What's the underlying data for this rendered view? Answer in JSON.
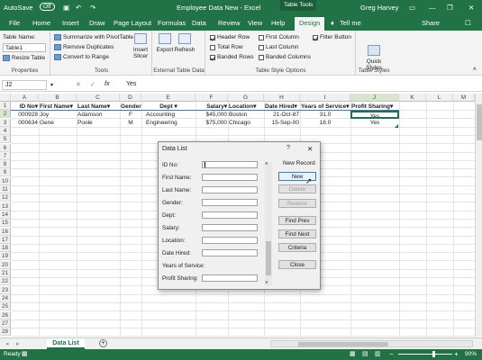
{
  "titlebar": {
    "autosave": "AutoSave",
    "autosave_state": "Off",
    "doc_title": "Employee Data New  -  Excel",
    "context_tab": "Table Tools",
    "user": "Greg Harvey"
  },
  "tabs": [
    "File",
    "Home",
    "Insert",
    "Draw",
    "Page Layout",
    "Formulas",
    "Data",
    "Review",
    "View",
    "Help",
    "Design"
  ],
  "tell_me": "Tell me",
  "share": "Share",
  "ribbon": {
    "properties": {
      "label": "Properties",
      "name_label": "Table Name:",
      "name_value": "Table1",
      "resize": "Resize Table"
    },
    "tools": {
      "label": "Tools",
      "items": [
        "Summarize with PivotTable",
        "Remove Duplicates",
        "Convert to Range"
      ],
      "slicer": "Insert Slicer"
    },
    "external": {
      "label": "External Table Data",
      "export": "Export",
      "refresh": "Refresh"
    },
    "style_options": {
      "label": "Table Style Options",
      "items": [
        {
          "label": "Header Row",
          "checked": true
        },
        {
          "label": "Total Row",
          "checked": false
        },
        {
          "label": "Banded Rows",
          "checked": true
        },
        {
          "label": "First Column",
          "checked": false
        },
        {
          "label": "Last Column",
          "checked": false
        },
        {
          "label": "Banded Columns",
          "checked": false
        },
        {
          "label": "Filter Button",
          "checked": true
        }
      ]
    },
    "styles": {
      "label": "Table Styles",
      "quick": "Quick Styles"
    }
  },
  "formula_bar": {
    "namebox": "J2",
    "fx": "fx",
    "value": "Yes"
  },
  "columns": [
    "A",
    "B",
    "C",
    "D",
    "E",
    "F",
    "G",
    "H",
    "I",
    "J",
    "K",
    "L",
    "M"
  ],
  "headers": [
    "ID No",
    "First Name",
    "Last Name",
    "Gender",
    "Dept",
    "Salary",
    "Location",
    "Date Hired",
    "Years of Service",
    "Profit Sharing"
  ],
  "rows": [
    [
      "000928",
      "Joy",
      "Adamson",
      "F",
      "Accounting",
      "$45,000",
      "Boston",
      "21-Oct-87",
      "31.0",
      "Yes"
    ],
    [
      "000634",
      "Gene",
      "Poole",
      "M",
      "Engineering",
      "$75,000",
      "Chicago",
      "15-Sep-00",
      "18.0",
      "Yes"
    ]
  ],
  "row_numbers": [
    "1",
    "2",
    "3",
    "4",
    "5",
    "6",
    "7",
    "8",
    "9",
    "10",
    "11",
    "12",
    "13",
    "14",
    "15",
    "16",
    "17",
    "18",
    "19",
    "20",
    "21",
    "22",
    "23",
    "24",
    "25",
    "26",
    "27",
    "28"
  ],
  "dialog": {
    "title": "Data List",
    "help": "?",
    "close": "✕",
    "record_status": "New Record",
    "fields": [
      "ID No:",
      "First Name:",
      "Last Name:",
      "Gender:",
      "Dept:",
      "Salary:",
      "Location:",
      "Date Hired:",
      "Years of Service:",
      "Profit Sharing:"
    ],
    "buttons": [
      {
        "label": "New",
        "disabled": false,
        "default": true
      },
      {
        "label": "Delete",
        "disabled": true,
        "default": false
      },
      {
        "label": "Restore",
        "disabled": true,
        "default": false
      },
      {
        "label": "Find Prev",
        "disabled": false,
        "default": false
      },
      {
        "label": "Find Next",
        "disabled": false,
        "default": false
      },
      {
        "label": "Criteria",
        "disabled": false,
        "default": false
      },
      {
        "label": "Close",
        "disabled": false,
        "default": false
      }
    ]
  },
  "sheet_tab": "Data List",
  "status": {
    "ready": "Ready",
    "zoom": "90%"
  },
  "colors": {
    "excel_green": "#217346",
    "table_header_line": "#4472c4"
  }
}
